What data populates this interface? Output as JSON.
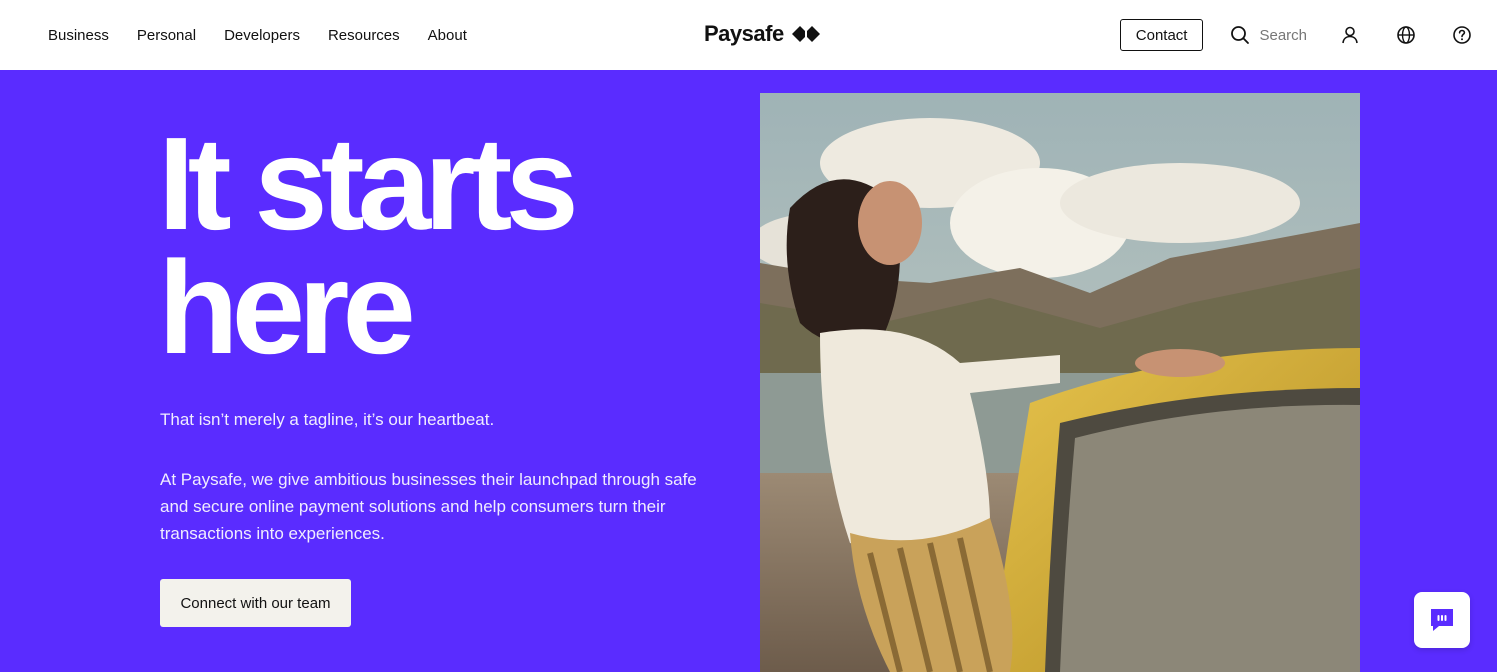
{
  "header": {
    "nav": [
      {
        "label": "Business"
      },
      {
        "label": "Personal"
      },
      {
        "label": "Developers"
      },
      {
        "label": "Resources"
      },
      {
        "label": "About"
      }
    ],
    "logo_text": "Paysafe",
    "contact_label": "Contact",
    "search_placeholder": "Search",
    "icons": [
      "search-icon",
      "user-icon",
      "globe-icon",
      "help-icon"
    ]
  },
  "hero": {
    "headline_line1": "It starts",
    "headline_line2": "here",
    "tagline": "That isn’t merely a tagline, it’s our heartbeat.",
    "description": "At Paysafe, we give ambitious businesses their launchpad through safe and secure online payment solutions and help consumers turn their transactions into experiences.",
    "cta_label": "Connect with our team",
    "image_alt": "Woman leaning on a yellow car by a mountain lake"
  },
  "chat": {
    "icon": "chat-icon"
  },
  "colors": {
    "brand_purple": "#5a2cff",
    "header_bg": "#ffffff",
    "cta_bg": "#f3f2ec"
  }
}
